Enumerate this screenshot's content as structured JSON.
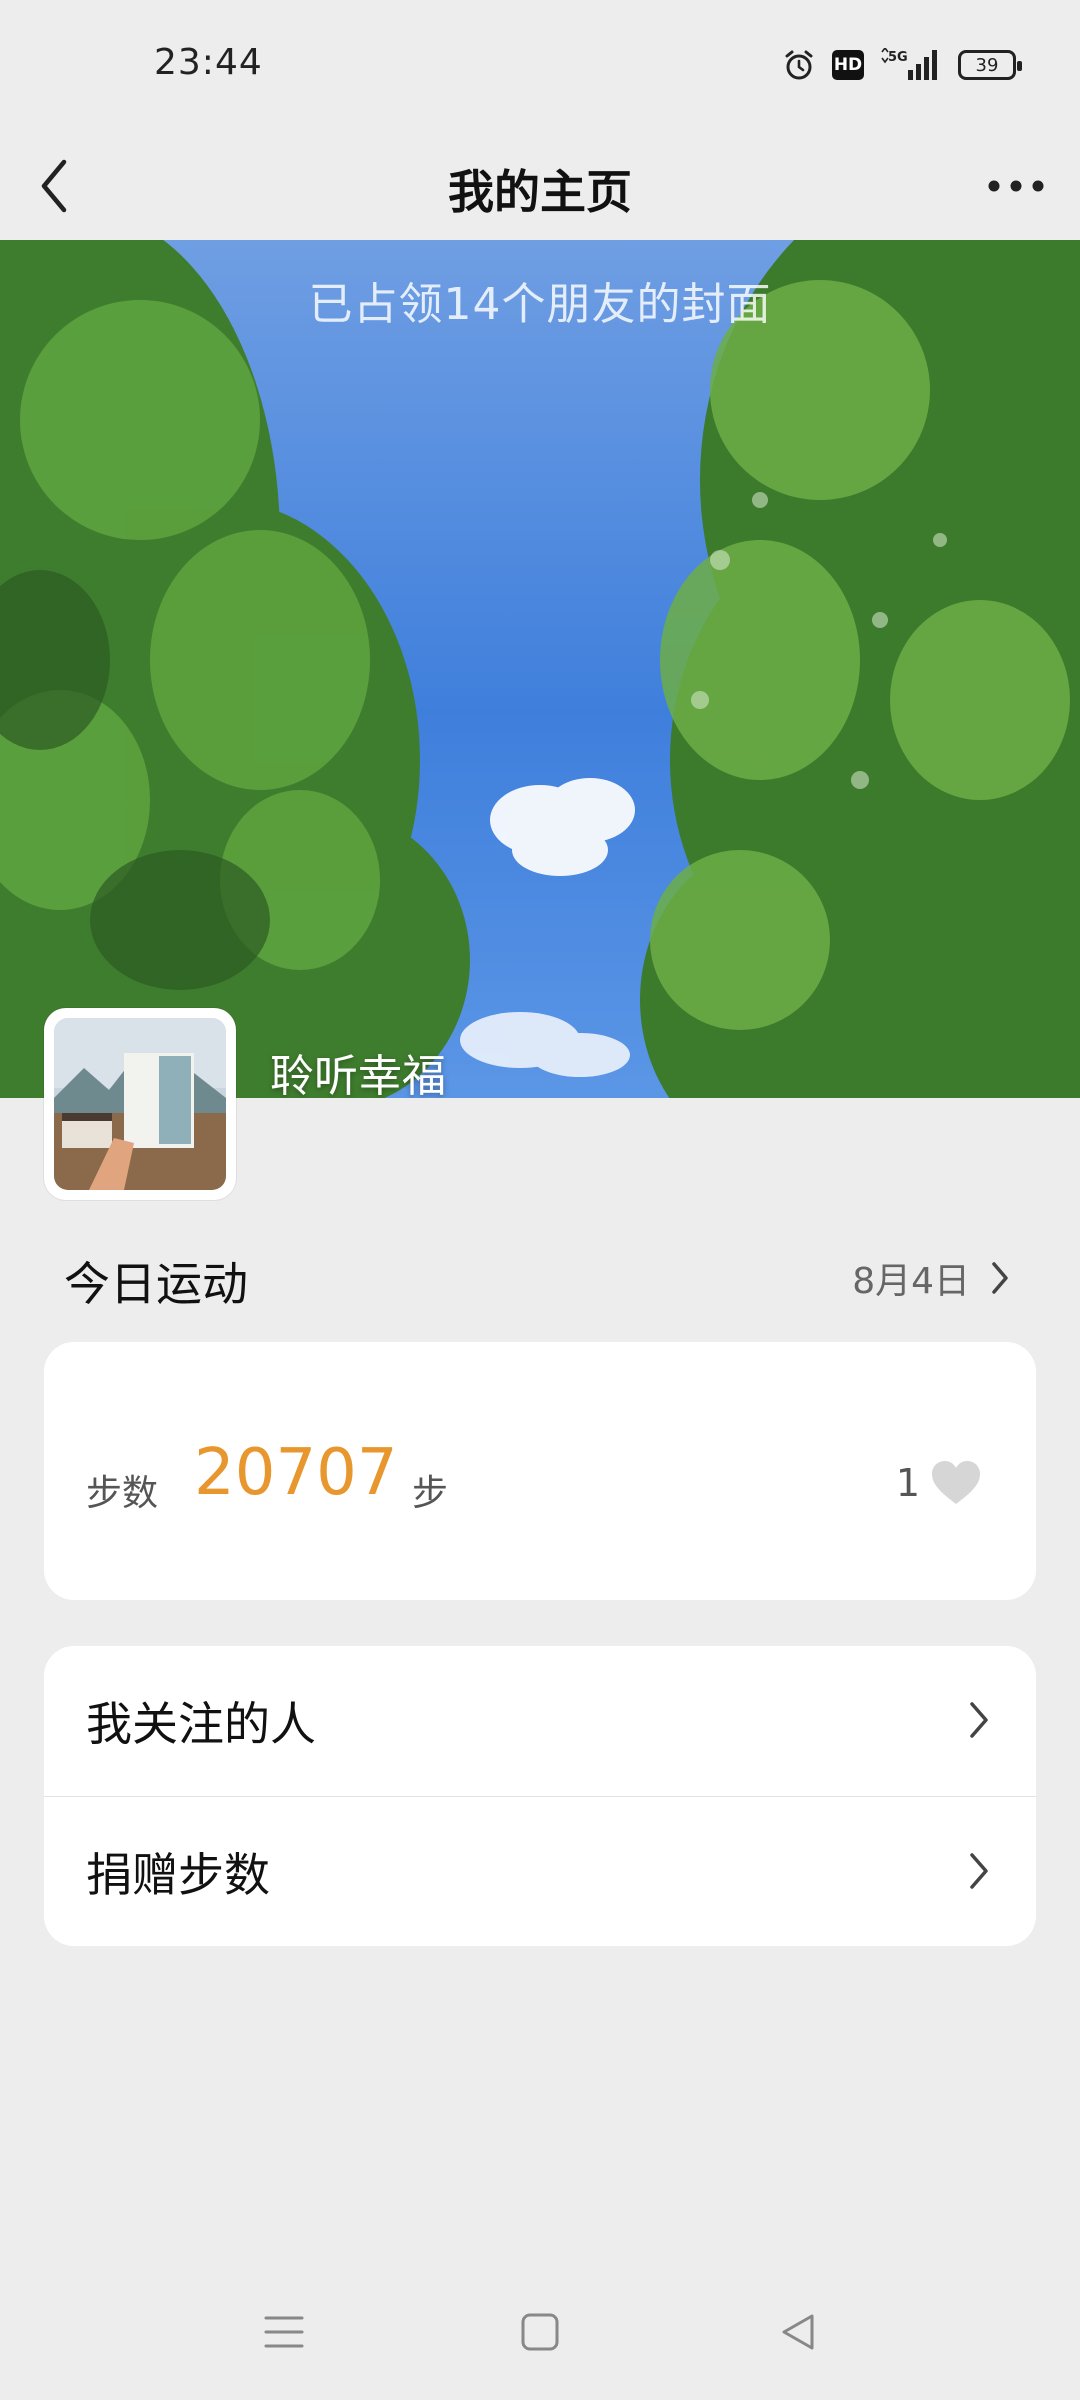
{
  "status_bar": {
    "time": "23:44",
    "signal_label": "5G",
    "battery": "39",
    "hd_label": "HD"
  },
  "header": {
    "title": "我的主页"
  },
  "cover": {
    "caption": "已占领14个朋友的封面",
    "username": "聆听幸福"
  },
  "today": {
    "title": "今日运动",
    "date": "8月4日",
    "steps_label": "步数",
    "steps_value": "20707",
    "steps_unit": "步",
    "likes": "1",
    "accent_color": "#e8962e"
  },
  "menu": {
    "items": [
      {
        "label": "我关注的人"
      },
      {
        "label": "捐赠步数"
      }
    ]
  },
  "icons": {
    "back": "chevron-left-icon",
    "more": "more-dots-icon",
    "heart": "heart-icon",
    "nav_menu": "menu-lines-icon",
    "nav_home": "square-home-icon",
    "nav_back": "triangle-back-icon"
  }
}
